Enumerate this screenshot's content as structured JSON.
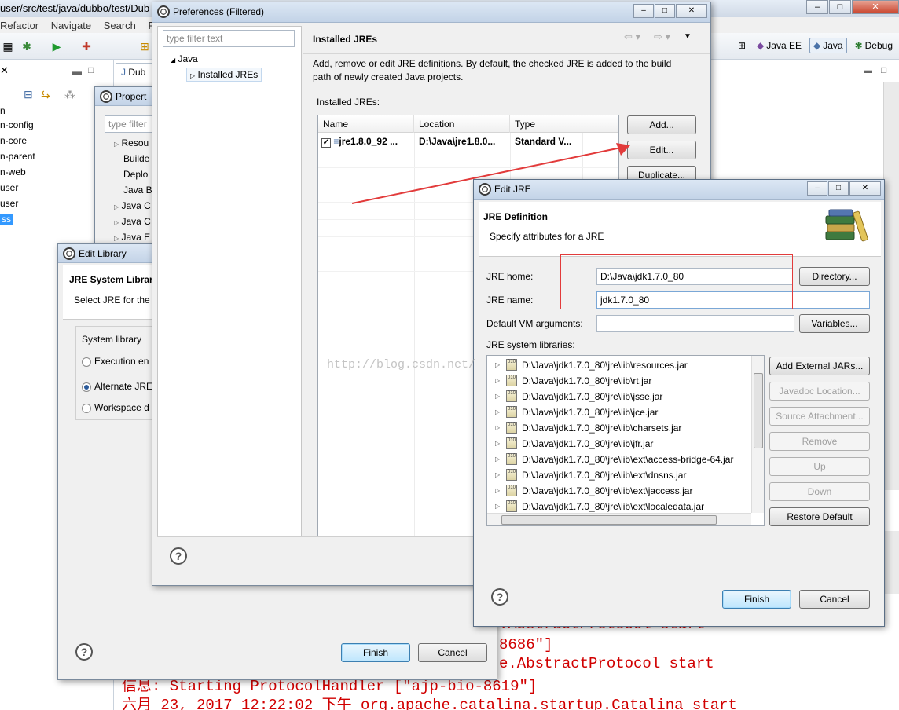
{
  "ide": {
    "path_title": "user/src/test/java/dubbo/test/Dub",
    "menu": [
      "Refactor",
      "Navigate",
      "Search",
      "Pr"
    ],
    "perspectives": [
      "Java EE",
      "Java",
      "Debug"
    ],
    "editor_tab": "Dub",
    "tree_items": [
      "n",
      "n-config",
      "n-core",
      "n-parent",
      "n-web",
      "user",
      "user",
      "ss"
    ]
  },
  "console": {
    "lines": [
      ".AbstractProtocol start",
      "8686\"]",
      "e.AbstractProtocol start",
      "信息: Starting ProtocolHandler [\"ajp-bio-8619\"]",
      "六月 23, 2017 12:22:02 下午 org.apache.catalina.startup.Catalina start"
    ]
  },
  "properties_dialog": {
    "title": "Propert",
    "filter_placeholder": "type filter",
    "items": [
      "Resou",
      "Builde",
      "Deplo",
      "Java B",
      "Java C",
      "Java C",
      "Java E"
    ]
  },
  "edit_library": {
    "title": "Edit Library",
    "heading": "JRE System Librar",
    "description": "Select JRE for the",
    "group_label": "System library",
    "radio_execution": "Execution en",
    "radio_alternate": "Alternate JRE",
    "radio_workspace": "Workspace d",
    "finish": "Finish",
    "cancel": "Cancel"
  },
  "preferences": {
    "title": "Preferences (Filtered)",
    "filter_placeholder": "type filter text",
    "tree_java": "Java",
    "tree_installed_jres": "Installed JREs",
    "page_title": "Installed JREs",
    "description": "Add, remove or edit JRE definitions. By default, the checked JRE is added to the build path of newly created Java projects.",
    "table_label": "Installed JREs:",
    "columns": [
      "Name",
      "Location",
      "Type"
    ],
    "row": {
      "name": "jre1.8.0_92 ...",
      "location": "D:\\Java\\jre1.8.0...",
      "type": "Standard V..."
    },
    "buttons": [
      "Add...",
      "Edit...",
      "Duplicate..."
    ]
  },
  "edit_jre": {
    "title": "Edit JRE",
    "heading": "JRE Definition",
    "subheading": "Specify attributes for a JRE",
    "jre_home_label": "JRE home:",
    "jre_home_value": "D:\\Java\\jdk1.7.0_80",
    "jre_name_label": "JRE name:",
    "jre_name_value": "jdk1.7.0_80",
    "vm_args_label": "Default VM arguments:",
    "vm_args_value": "",
    "libraries_label": "JRE system libraries:",
    "directory_button": "Directory...",
    "variables_button": "Variables...",
    "libraries": [
      "D:\\Java\\jdk1.7.0_80\\jre\\lib\\resources.jar",
      "D:\\Java\\jdk1.7.0_80\\jre\\lib\\rt.jar",
      "D:\\Java\\jdk1.7.0_80\\jre\\lib\\jsse.jar",
      "D:\\Java\\jdk1.7.0_80\\jre\\lib\\jce.jar",
      "D:\\Java\\jdk1.7.0_80\\jre\\lib\\charsets.jar",
      "D:\\Java\\jdk1.7.0_80\\jre\\lib\\jfr.jar",
      "D:\\Java\\jdk1.7.0_80\\jre\\lib\\ext\\access-bridge-64.jar",
      "D:\\Java\\jdk1.7.0_80\\jre\\lib\\ext\\dnsns.jar",
      "D:\\Java\\jdk1.7.0_80\\jre\\lib\\ext\\jaccess.jar",
      "D:\\Java\\jdk1.7.0_80\\jre\\lib\\ext\\localedata.jar"
    ],
    "side_buttons": [
      "Add External JARs...",
      "Javadoc Location...",
      "Source Attachment...",
      "Remove",
      "Up",
      "Down",
      "Restore Default"
    ],
    "finish": "Finish",
    "cancel": "Cancel"
  },
  "watermark": "http://blog.csdn.net/",
  "colors": {
    "annotation_red": "#e23b3b",
    "console_red": "#d10000"
  }
}
